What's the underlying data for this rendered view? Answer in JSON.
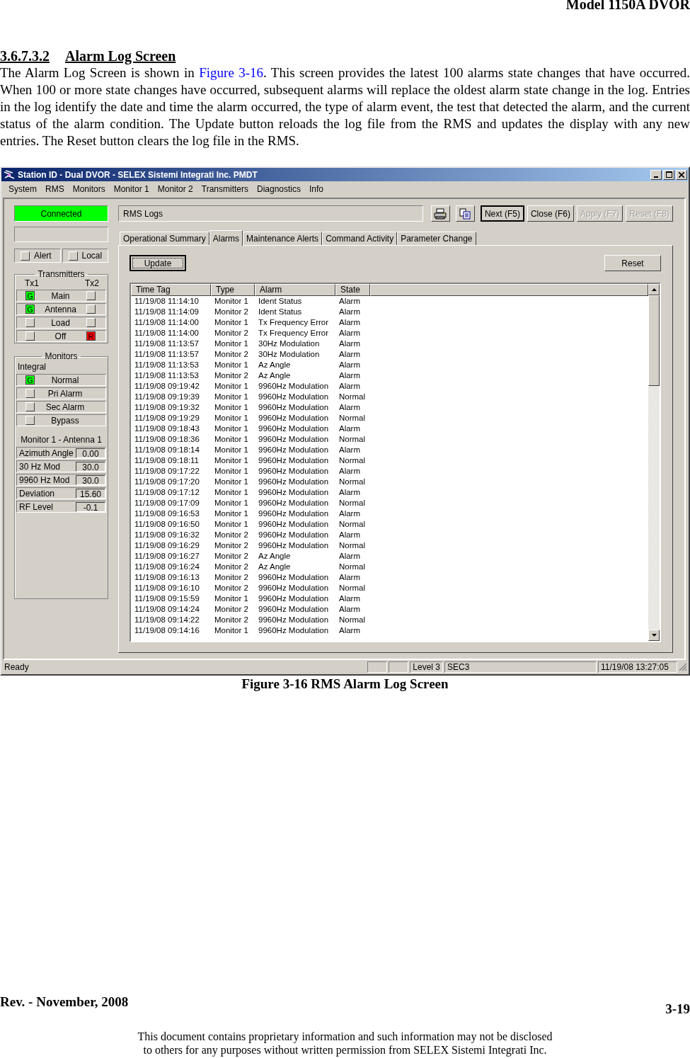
{
  "page_header": "Model 1150A DVOR",
  "section": {
    "number": "3.6.7.3.2",
    "title": "Alarm Log Screen"
  },
  "paragraph": {
    "before": "The Alarm Log Screen is shown in ",
    "link": "Figure 3-16",
    "after": ".  This screen provides the latest 100 alarms state changes that have occurred. When 100 or more state changes have occurred, subsequent alarms will replace the oldest alarm state change in the log.  Entries in the log identify the date and time the alarm occurred, the type of alarm event, the test that detected the alarm, and the current status of the alarm condition. The Update button reloads the log file from the RMS and updates the display with any new entries.  The Reset button clears the log file in the RMS."
  },
  "window": {
    "title": "Station ID - Dual DVOR - SELEX Sistemi Integrati Inc. PMDT",
    "menu": [
      "System",
      "RMS",
      "Monitors",
      "Monitor 1",
      "Monitor 2",
      "Transmitters",
      "Diagnostics",
      "Info"
    ],
    "connection": "Connected",
    "flags": [
      {
        "label": "Alert",
        "lit": false
      },
      {
        "label": "Local",
        "lit": false
      }
    ],
    "transmitters": {
      "title": "Transmitters",
      "col_left": "Tx1",
      "col_right": "Tx2",
      "rows": [
        {
          "label": "Main",
          "left": {
            "lit": true,
            "text": "G",
            "color": "#00ff00"
          },
          "right": {
            "lit": false
          }
        },
        {
          "label": "Antenna",
          "left": {
            "lit": true,
            "text": "G",
            "color": "#00ff00"
          },
          "right": {
            "lit": false
          }
        },
        {
          "label": "Load",
          "left": {
            "lit": false
          },
          "right": {
            "lit": false
          }
        },
        {
          "label": "Off",
          "left": {
            "lit": false
          },
          "right": {
            "lit": true,
            "text": "R",
            "color": "#ff0000"
          }
        }
      ]
    },
    "monitors": {
      "title": "Monitors",
      "subtitle": "Integral",
      "rows": [
        {
          "label": "Normal",
          "lamp": {
            "lit": true,
            "text": "G",
            "color": "#00ff00"
          }
        },
        {
          "label": "Pri Alarm",
          "lamp": {
            "lit": false
          }
        },
        {
          "label": "Sec Alarm",
          "lamp": {
            "lit": false
          }
        },
        {
          "label": "Bypass",
          "lamp": {
            "lit": false
          }
        }
      ],
      "readings_title": "Monitor 1 - Antenna 1",
      "readings": [
        {
          "label": "Azimuth Angle",
          "value": "0.00"
        },
        {
          "label": "30 Hz Mod",
          "value": "30.0"
        },
        {
          "label": "9960 Hz Mod",
          "value": "30.0"
        },
        {
          "label": "Deviation",
          "value": "15.60"
        },
        {
          "label": "RF Level",
          "value": "-0.1"
        }
      ]
    },
    "screen_name": "RMS Logs",
    "toolbar": [
      {
        "kind": "print"
      },
      {
        "kind": "copy"
      },
      {
        "kind": "text",
        "label": "Next (F5)",
        "disabled": false,
        "default": true
      },
      {
        "kind": "text",
        "label": "Close (F6)",
        "disabled": false,
        "default": false
      },
      {
        "kind": "text",
        "label": "Apply (F7)",
        "disabled": true,
        "default": false
      },
      {
        "kind": "text",
        "label": "Reset (F8)",
        "disabled": true,
        "default": false
      }
    ],
    "tabs": [
      {
        "label": "Operational Summary",
        "selected": false
      },
      {
        "label": "Alarms",
        "selected": true
      },
      {
        "label": "Maintenance Alerts",
        "selected": false
      },
      {
        "label": "Command Activity",
        "selected": false
      },
      {
        "label": "Parameter Change",
        "selected": false
      }
    ],
    "update_button": "Update",
    "reset_button": "Reset",
    "table": {
      "columns": [
        "Time Tag",
        "Type",
        "Alarm",
        "State"
      ],
      "rows": [
        [
          "11/19/08 11:14:10",
          "Monitor 1",
          "Ident Status",
          "Alarm"
        ],
        [
          "11/19/08 11:14:09",
          "Monitor 2",
          "Ident Status",
          "Alarm"
        ],
        [
          "11/19/08 11:14:00",
          "Monitor 1",
          "Tx Frequency Error",
          "Alarm"
        ],
        [
          "11/19/08 11:14:00",
          "Monitor 2",
          "Tx Frequency Error",
          "Alarm"
        ],
        [
          "11/19/08 11:13:57",
          "Monitor 1",
          "30Hz Modulation",
          "Alarm"
        ],
        [
          "11/19/08 11:13:57",
          "Monitor 2",
          "30Hz Modulation",
          "Alarm"
        ],
        [
          "11/19/08 11:13:53",
          "Monitor 1",
          "Az Angle",
          "Alarm"
        ],
        [
          "11/19/08 11:13:53",
          "Monitor 2",
          "Az Angle",
          "Alarm"
        ],
        [
          "11/19/08 09:19:42",
          "Monitor 1",
          "9960Hz Modulation",
          "Alarm"
        ],
        [
          "11/19/08 09:19:39",
          "Monitor 1",
          "9960Hz Modulation",
          "Normal"
        ],
        [
          "11/19/08 09:19:32",
          "Monitor 1",
          "9960Hz Modulation",
          "Alarm"
        ],
        [
          "11/19/08 09:19:29",
          "Monitor 1",
          "9960Hz Modulation",
          "Normal"
        ],
        [
          "11/19/08 09:18:43",
          "Monitor 1",
          "9960Hz Modulation",
          "Alarm"
        ],
        [
          "11/19/08 09:18:36",
          "Monitor 1",
          "9960Hz Modulation",
          "Normal"
        ],
        [
          "11/19/08 09:18:14",
          "Monitor 1",
          "9960Hz Modulation",
          "Alarm"
        ],
        [
          "11/19/08 09:18:11",
          "Monitor 1",
          "9960Hz Modulation",
          "Normal"
        ],
        [
          "11/19/08 09:17:22",
          "Monitor 1",
          "9960Hz Modulation",
          "Alarm"
        ],
        [
          "11/19/08 09:17:20",
          "Monitor 1",
          "9960Hz Modulation",
          "Normal"
        ],
        [
          "11/19/08 09:17:12",
          "Monitor 1",
          "9960Hz Modulation",
          "Alarm"
        ],
        [
          "11/19/08 09:17:09",
          "Monitor 1",
          "9960Hz Modulation",
          "Normal"
        ],
        [
          "11/19/08 09:16:53",
          "Monitor 1",
          "9960Hz Modulation",
          "Alarm"
        ],
        [
          "11/19/08 09:16:50",
          "Monitor 1",
          "9960Hz Modulation",
          "Normal"
        ],
        [
          "11/19/08 09:16:32",
          "Monitor 2",
          "9960Hz Modulation",
          "Alarm"
        ],
        [
          "11/19/08 09:16:29",
          "Monitor 2",
          "9960Hz Modulation",
          "Normal"
        ],
        [
          "11/19/08 09:16:27",
          "Monitor 2",
          "Az Angle",
          "Alarm"
        ],
        [
          "11/19/08 09:16:24",
          "Monitor 2",
          "Az Angle",
          "Normal"
        ],
        [
          "11/19/08 09:16:13",
          "Monitor 2",
          "9960Hz Modulation",
          "Alarm"
        ],
        [
          "11/19/08 09:16:10",
          "Monitor 2",
          "9960Hz Modulation",
          "Normal"
        ],
        [
          "11/19/08 09:15:59",
          "Monitor 1",
          "9960Hz Modulation",
          "Alarm"
        ],
        [
          "11/19/08 09:14:24",
          "Monitor 2",
          "9960Hz Modulation",
          "Alarm"
        ],
        [
          "11/19/08 09:14:22",
          "Monitor 2",
          "9960Hz Modulation",
          "Normal"
        ],
        [
          "11/19/08 09:14:16",
          "Monitor 1",
          "9960Hz Modulation",
          "Alarm"
        ]
      ]
    },
    "status_bar": {
      "message": "Ready",
      "level": "Level 3",
      "sector": "SEC3",
      "time": "11/19/08 13:27:05"
    }
  },
  "caption": "Figure 3-16  RMS Alarm Log Screen",
  "footer": {
    "revision": "Rev. -  November, 2008",
    "page": "3-19"
  },
  "notice": [
    "This document contains proprietary information and such information may not be disclosed",
    "to others for any purposes without written permission from SELEX Sistemi Integrati Inc."
  ]
}
